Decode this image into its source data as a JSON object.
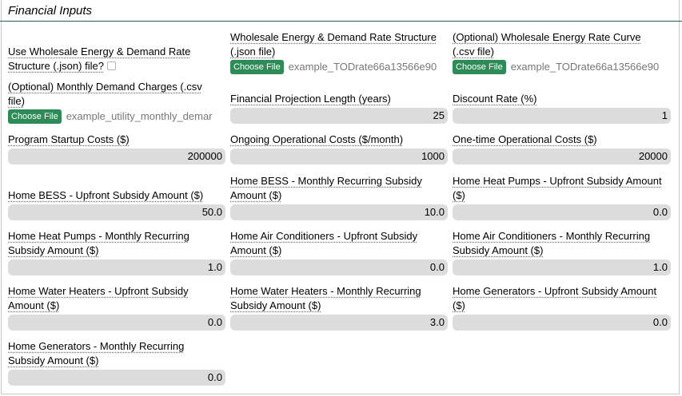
{
  "section": {
    "title": "Financial Inputs"
  },
  "fields": {
    "wholesale_json_toggle": {
      "line1": "Use Wholesale Energy & Demand Rate",
      "line2": "Structure (.json) file?",
      "checked": false
    },
    "wholesale_json": {
      "line1": "Wholesale Energy & Demand Rate Structure",
      "line2": "(.json file)",
      "button": "Choose File",
      "file": "example_TODrate66a13566e90"
    },
    "wholesale_curve": {
      "line1": "(Optional) Wholesale Energy Rate Curve",
      "line2": "(.csv file)",
      "button": "Choose File",
      "file": "example_TODrate66a13566e90"
    },
    "monthly_demand": {
      "line1": "(Optional) Monthly Demand Charges (.csv",
      "line2": "file)",
      "button": "Choose File",
      "file": "example_utility_monthly_demar"
    },
    "projection_length": {
      "label": "Financial Projection Length (years)",
      "value": "25"
    },
    "discount_rate": {
      "label": "Discount Rate (%)",
      "value": "1"
    },
    "startup_costs": {
      "label": "Program Startup Costs ($)",
      "value": "200000"
    },
    "ongoing_costs": {
      "label": "Ongoing Operational Costs ($/month)",
      "value": "1000"
    },
    "onetime_costs": {
      "label": "One-time Operational Costs ($)",
      "value": "20000"
    },
    "bess_upfront": {
      "line1": "Home BESS - Upfront Subsidy Amount ($)",
      "value": "50.0"
    },
    "bess_monthly": {
      "line1": "Home BESS - Monthly Recurring Subsidy",
      "line2": "Amount ($)",
      "value": "10.0"
    },
    "heatpump_upfront": {
      "line1": "Home Heat Pumps - Upfront Subsidy Amount",
      "line2": "($)",
      "value": "0.0"
    },
    "heatpump_monthly": {
      "line1": "Home Heat Pumps - Monthly Recurring",
      "line2": "Subsidy Amount ($)",
      "value": "1.0"
    },
    "ac_upfront": {
      "line1": "Home Air Conditioners - Upfront Subsidy",
      "line2": "Amount ($)",
      "value": "0.0"
    },
    "ac_monthly": {
      "line1": "Home Air Conditioners - Monthly Recurring",
      "line2": "Subsidy Amount ($)",
      "value": "1.0"
    },
    "waterheater_upfront": {
      "line1": "Home Water Heaters - Upfront Subsidy",
      "line2": "Amount ($)",
      "value": "0.0"
    },
    "waterheater_monthly": {
      "line1": "Home Water Heaters - Monthly Recurring",
      "line2": "Subsidy Amount ($)",
      "value": "3.0"
    },
    "generator_upfront": {
      "line1": "Home Generators - Upfront Subsidy Amount",
      "line2": "($)",
      "value": "0.0"
    },
    "generator_monthly": {
      "line1": "Home Generators - Monthly Recurring",
      "line2": "Subsidy Amount ($)",
      "value": "0.0"
    }
  }
}
